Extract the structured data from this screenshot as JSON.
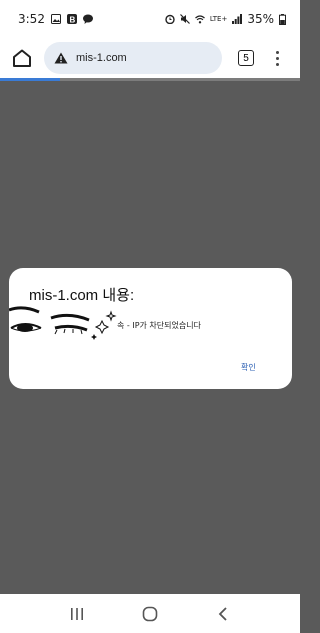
{
  "status_bar": {
    "time": "3:52",
    "signal_label": "LTE+",
    "battery_percent": "35%",
    "progress_fraction": 0.2
  },
  "browser": {
    "url": "mis-1.com",
    "tab_count": "5"
  },
  "dialog": {
    "title": "mis-1.com 내용:",
    "message": "속 - IP가 차단되었습니다",
    "confirm_label": "확인"
  },
  "colors": {
    "page_overlay": "#5a5a5a",
    "url_bar": "#e6ecf4",
    "dialog_bg": "#ffffff",
    "confirm_text": "#2b5fb3"
  }
}
